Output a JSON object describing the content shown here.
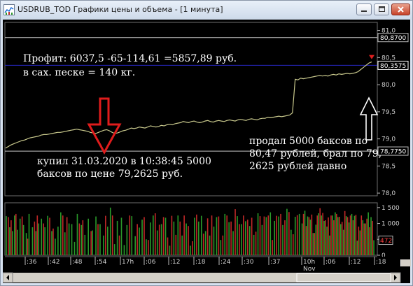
{
  "window": {
    "title": "USDRUB_TOD Графики цены и объема - [1 минута]",
    "minimize_icon": "minimize-icon",
    "maximize_icon": "maximize-icon",
    "close_icon": "close-icon"
  },
  "notes": {
    "profit_line1": "Профит:   6037,5 -65-114,61   =5857,89 руб.",
    "profit_line2": "в сах. песке                        = 140 кг.",
    "bought_line1": "купил 31.03.2020  в 10:38:45   5000",
    "bought_line2": "баксов по цене 79,2625 руб.",
    "sold_line1": "продал 5000 баксов по",
    "sold_line2": "80,47 рублей, брал по 79,",
    "sold_line3": "2625 рублей давно"
  },
  "chart_data": [
    {
      "type": "line",
      "title": "",
      "ylim": [
        77.95,
        81.15
      ],
      "y_ticks": [
        "81,0",
        "80,5",
        "80,0",
        "79,5",
        "79,0",
        "78,5",
        "78,0"
      ],
      "y_tick_values": [
        81.0,
        80.5,
        80.0,
        79.5,
        79.0,
        78.5,
        78.0
      ],
      "price_labels": [
        {
          "text": "80,8700",
          "value": 80.87
        },
        {
          "text": "80,3575",
          "value": 80.3575,
          "style": "current"
        },
        {
          "text": "78,7750",
          "value": 78.775
        }
      ],
      "horizontal_lines": [
        {
          "value": 80.87,
          "color": "#c8c8c8"
        },
        {
          "value": 80.3575,
          "color": "#2828c8"
        },
        {
          "value": 78.775,
          "color": "#c8c8c8"
        }
      ],
      "series": [
        {
          "color": "#c8c88c",
          "x": [
            0,
            4,
            8,
            12,
            16,
            20,
            24,
            28,
            32,
            36,
            40,
            44,
            48,
            52,
            56,
            60,
            64,
            68,
            72,
            76,
            80,
            84,
            88,
            92,
            96,
            100,
            104,
            108,
            112,
            116,
            120,
            124,
            128,
            132,
            136,
            140,
            144,
            148,
            152,
            156,
            160,
            164,
            168,
            172,
            176,
            180,
            184,
            188,
            192,
            196,
            200,
            204,
            208,
            212,
            216,
            220,
            224,
            228,
            232,
            236,
            240,
            244,
            248,
            252,
            256,
            260,
            264,
            268,
            272,
            276,
            280,
            284,
            288,
            292,
            296,
            300,
            304,
            308,
            312,
            316,
            320,
            324,
            328,
            332,
            336,
            340,
            344,
            348,
            352,
            356,
            360,
            364,
            368,
            372,
            376,
            380,
            384,
            388,
            392,
            396,
            400,
            404,
            408,
            412,
            416,
            420,
            424,
            428,
            432,
            436,
            440,
            444,
            448,
            452,
            456,
            460,
            464,
            468,
            472,
            476,
            480,
            484,
            488,
            492,
            496,
            500,
            504,
            508,
            512,
            516,
            520,
            524,
            528,
            532,
            536
          ],
          "values": [
            78.83,
            78.86,
            78.89,
            78.91,
            78.93,
            78.95,
            78.97,
            78.98,
            79.0,
            79.02,
            79.03,
            79.04,
            79.05,
            79.07,
            79.08,
            79.08,
            79.09,
            79.1,
            79.11,
            79.12,
            79.12,
            79.13,
            79.14,
            79.15,
            79.16,
            79.17,
            79.18,
            79.17,
            79.16,
            79.15,
            79.14,
            79.12,
            79.11,
            79.1,
            79.12,
            79.14,
            79.16,
            79.17,
            79.15,
            79.12,
            79.1,
            79.11,
            79.13,
            79.15,
            79.16,
            79.18,
            79.2,
            79.19,
            79.2,
            79.22,
            79.21,
            79.2,
            79.22,
            79.24,
            79.23,
            79.22,
            79.23,
            79.25,
            79.24,
            79.26,
            79.27,
            79.26,
            79.28,
            79.29,
            79.3,
            79.32,
            79.31,
            79.3,
            79.32,
            79.33,
            79.31,
            79.3,
            79.31,
            79.33,
            79.34,
            79.32,
            79.31,
            79.33,
            79.34,
            79.33,
            79.32,
            79.34,
            79.35,
            79.34,
            79.33,
            79.35,
            79.36,
            79.35,
            79.34,
            79.36,
            79.37,
            79.36,
            79.35,
            79.37,
            79.38,
            79.38,
            79.4,
            79.39,
            79.4,
            79.41,
            79.42,
            79.41,
            79.42,
            79.43,
            79.44,
            79.48,
            80.1,
            80.09,
            80.12,
            80.11,
            80.12,
            80.13,
            80.14,
            80.15,
            80.16,
            80.17,
            80.16,
            80.17,
            80.16,
            80.18,
            80.19,
            80.18,
            80.2,
            80.19,
            80.2,
            80.21,
            80.2,
            80.21,
            80.22,
            80.24,
            80.28,
            80.32,
            80.36,
            80.4,
            80.42
          ]
        }
      ]
    },
    {
      "type": "bar",
      "title": "",
      "ylim": [
        0,
        1650
      ],
      "y_ticks": [
        "1 500",
        "1 000",
        "500",
        "0"
      ],
      "y_tick_values": [
        1500,
        1000,
        500,
        0
      ],
      "current_label": {
        "text": "472",
        "value": 472
      },
      "series": [
        {
          "name": "",
          "color": "#2a9a2a",
          "x": [
            1,
            6,
            10,
            13,
            17,
            21,
            26,
            30,
            34,
            39,
            44,
            48,
            52,
            57,
            61,
            67,
            72,
            76,
            80,
            86,
            92,
            96,
            100,
            104,
            110,
            115,
            120,
            126,
            131,
            137,
            142,
            148,
            152,
            158,
            162,
            168,
            172,
            176,
            183,
            188,
            194,
            198,
            204,
            210,
            214,
            220,
            226,
            232,
            238,
            244,
            250,
            256,
            262,
            268,
            274,
            280,
            284,
            290,
            296,
            302,
            306,
            312,
            318,
            324,
            330,
            336,
            342,
            348,
            354,
            360,
            366,
            372,
            378,
            384,
            390,
            396,
            402,
            408,
            414,
            420,
            426,
            430,
            434,
            438,
            442,
            446,
            450,
            454,
            458,
            462,
            466,
            470,
            474,
            478,
            482,
            486,
            490,
            494,
            498,
            502,
            506,
            510,
            514,
            518,
            522,
            526,
            530,
            534
          ],
          "values": [
            1230,
            880,
            760,
            1250,
            800,
            1150,
            950,
            700,
            1300,
            880,
            760,
            1000,
            1150,
            880,
            1240,
            760,
            520,
            900,
            1350,
            720,
            1000,
            980,
            420,
            1300,
            950,
            640,
            1150,
            780,
            1220,
            980,
            620,
            900,
            1500,
            350,
            1080,
            1180,
            320,
            950,
            1230,
            600,
            870,
            1120,
            500,
            1030,
            1250,
            780,
            980,
            1180,
            300,
            1060,
            1250,
            620,
            1000,
            300,
            1180,
            1060,
            1240,
            760,
            620,
            900,
            1200,
            480,
            1300,
            1040,
            760,
            1230,
            980,
            1070,
            920,
            640,
            1320,
            950,
            1200,
            1350,
            1080,
            1220,
            950,
            1460,
            800,
            1210,
            1300,
            1000,
            1400,
            1220,
            1120,
            700,
            960,
            1320,
            1250,
            1080,
            900,
            620,
            1250,
            1350,
            1200,
            980,
            800,
            1230,
            1030,
            1300,
            1240,
            460,
            780,
            1100,
            1000,
            1350,
            1200,
            472
          ]
        },
        {
          "name": "",
          "color": "#c02828",
          "x": [
            4,
            8,
            15,
            24,
            32,
            42,
            46,
            55,
            64,
            69,
            83,
            89,
            107,
            112,
            124,
            134,
            145,
            155,
            165,
            180,
            191,
            201,
            207,
            217,
            223,
            229,
            235,
            241,
            247,
            253,
            259,
            265,
            271,
            277,
            287,
            293,
            299,
            309,
            315,
            321,
            327,
            333,
            339,
            345,
            351,
            357,
            363,
            369,
            375,
            381,
            387,
            393,
            399,
            405,
            411,
            417,
            423,
            432,
            436,
            440,
            444,
            448,
            452,
            456,
            460,
            464,
            468,
            472,
            476,
            480,
            484,
            488,
            492,
            496,
            500,
            504,
            508,
            512,
            516,
            520,
            524,
            528,
            532
          ],
          "values": [
            1200,
            1100,
            1300,
            1220,
            520,
            1060,
            1250,
            1000,
            1180,
            840,
            1250,
            1200,
            1000,
            1100,
            760,
            980,
            1240,
            1250,
            620,
            1250,
            980,
            1200,
            480,
            1320,
            960,
            1200,
            560,
            1240,
            640,
            1060,
            1250,
            920,
            440,
            1280,
            680,
            1160,
            1250,
            1220,
            620,
            1250,
            1060,
            1450,
            980,
            1250,
            1120,
            1180,
            740,
            1230,
            1220,
            1250,
            480,
            1240,
            1300,
            1100,
            1360,
            660,
            1260,
            1300,
            920,
            1200,
            1280,
            700,
            1250,
            1480,
            1330,
            1100,
            1190,
            1250,
            1100,
            1300,
            1210,
            1050,
            1390,
            1200,
            1250,
            1100,
            1270,
            900,
            1250,
            1000,
            1150,
            880,
            1080
          ]
        }
      ]
    }
  ],
  "time_axis": {
    "ticks": [
      ":36",
      ":42",
      ":48",
      ":54",
      "17h",
      ":06",
      ":12",
      ":18",
      ":24",
      ":30",
      ":37",
      "10h",
      ":06",
      ":12",
      ":18"
    ],
    "tick_x": [
      32,
      65,
      97,
      132,
      168,
      202,
      237,
      273,
      309,
      342,
      380,
      427,
      459,
      495,
      531
    ],
    "date_label": "Nov"
  }
}
